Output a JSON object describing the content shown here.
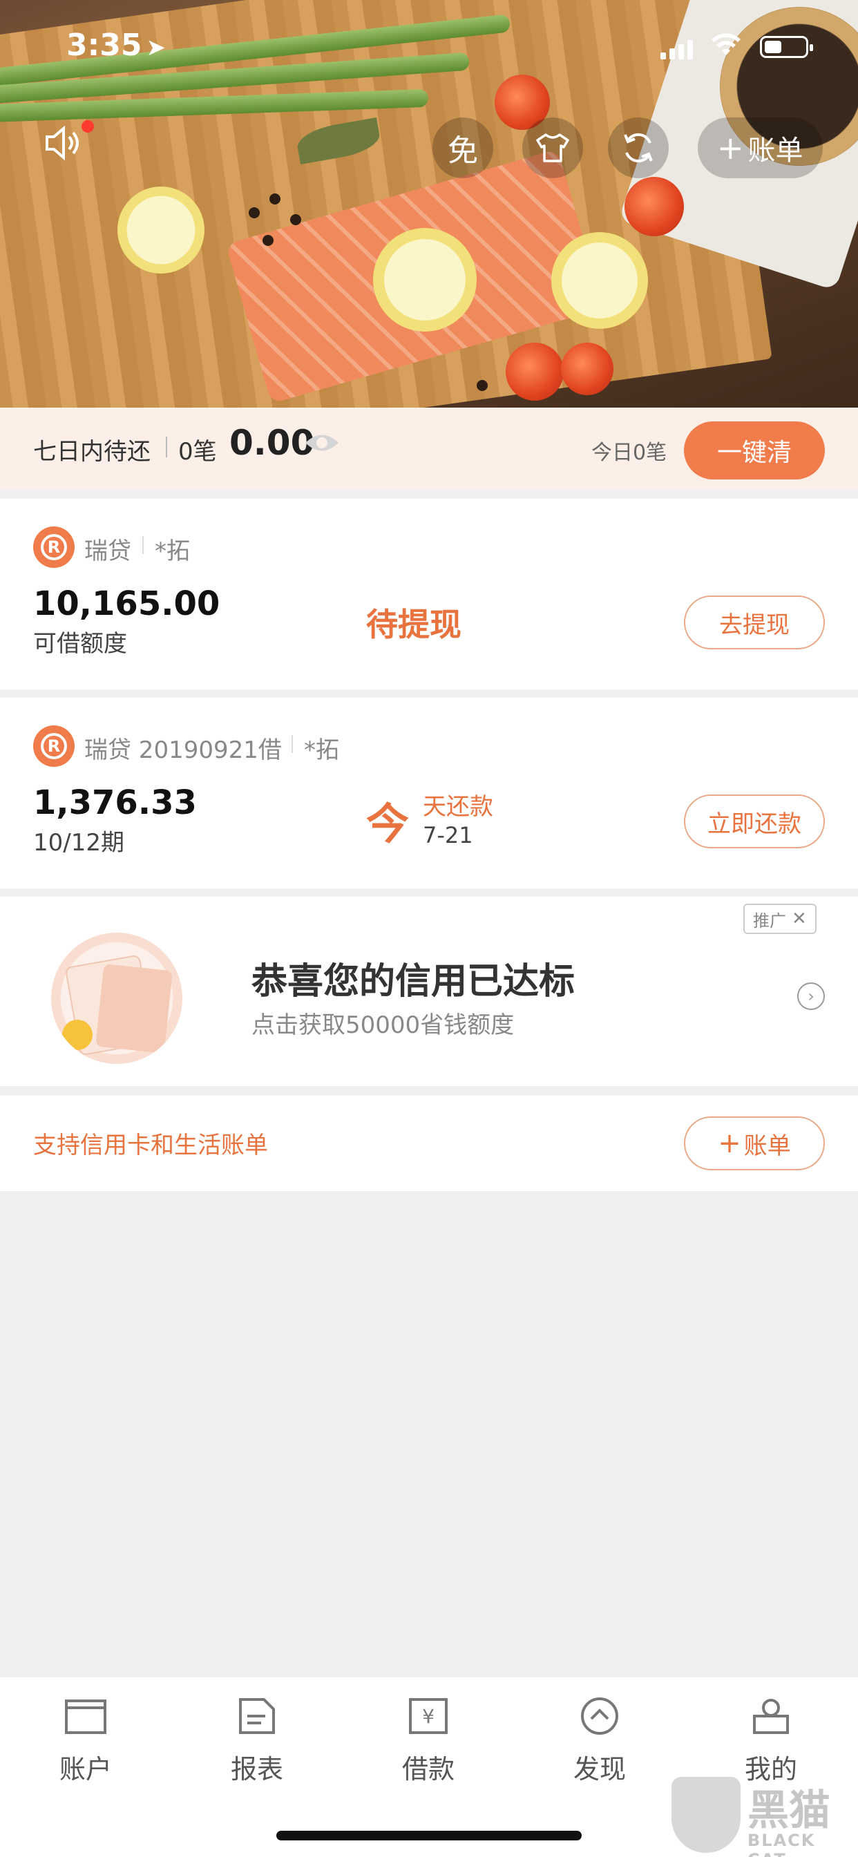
{
  "status_bar": {
    "time": "3:35"
  },
  "hero": {
    "free_label": "免",
    "add_bill_label": "账单"
  },
  "summary": {
    "label": "七日内待还",
    "count": "0笔",
    "amount": "0.00",
    "today": "今日0笔",
    "clear_button": "一键清"
  },
  "loan_card": {
    "product": "瑞贷",
    "account": "*拓",
    "amount": "10,165.00",
    "amount_label": "可借额度",
    "status": "待提现",
    "button": "去提现"
  },
  "repay_card": {
    "product": "瑞贷 20190921借",
    "account": "*拓",
    "amount": "1,376.33",
    "period": "10/12期",
    "today_icon": "今",
    "due_label": "天还款",
    "due_date": "7-21",
    "button": "立即还款"
  },
  "promo": {
    "tag": "推广",
    "title": "恭喜您的信用已达标",
    "subtitle": "点击获取50000省钱额度"
  },
  "bill_row": {
    "text": "支持信用卡和生活账单",
    "button": "账单"
  },
  "tabs": [
    {
      "label": "账户",
      "icon": "wallet-icon"
    },
    {
      "label": "报表",
      "icon": "report-icon"
    },
    {
      "label": "借款",
      "icon": "loan-icon"
    },
    {
      "label": "发现",
      "icon": "compass-icon"
    },
    {
      "label": "我的",
      "icon": "profile-icon"
    }
  ],
  "watermark": {
    "cn": "黑猫",
    "en": "BLACK CAT"
  },
  "colors": {
    "accent": "#f07c4c",
    "accent_text": "#e8733f",
    "summary_bg": "#fcefe8",
    "page_bg": "#f0f0f0"
  }
}
